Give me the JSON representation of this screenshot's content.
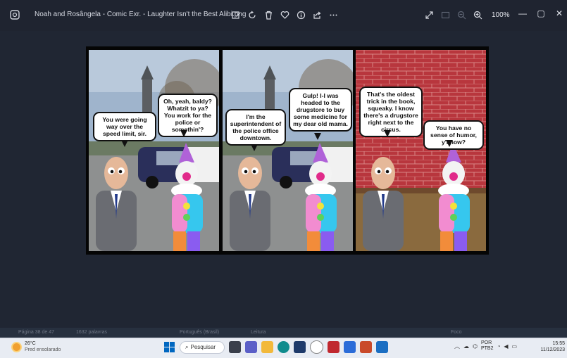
{
  "titlebar": {
    "filename": "Noah and Rosângela - Comic Exr. - Laughter Isn't the Best Alibi.png",
    "zoom": "100%",
    "tools": [
      "edit-icon",
      "rotate-icon",
      "delete-icon",
      "favorite-icon",
      "info-icon",
      "share-icon",
      "more-icon"
    ],
    "right_tools": [
      "fullscreen-icon",
      "fit-icon",
      "zoom-out-icon",
      "zoom-in-icon"
    ]
  },
  "comic": {
    "panels": [
      {
        "bubbles": [
          "You were going way over the speed limit, sir.",
          "Oh, yeah, baldy? Whatzit to ya? You work for the police or somethin'?"
        ]
      },
      {
        "bubbles": [
          "I'm the superintendent of the police office downtown.",
          "Gulp! I-I was headed to the drugstore to buy some medicine for my dear old mama."
        ]
      },
      {
        "bubbles": [
          "That's the oldest trick in the book, squeaky. I know there's a drugstore right next to the circus.",
          "You have no sense of humor, y'know?"
        ]
      }
    ]
  },
  "background_strip": [
    "Página 38 de 47",
    "1632 palavras",
    "Português (Brasil)",
    "Leitura",
    "Foco"
  ],
  "taskbar": {
    "weather_temp": "26°C",
    "weather_desc": "Pred ensolarado",
    "search_label": "Pesquisar",
    "lang_top": "POR",
    "lang_bottom": "PTB2",
    "time": "15:55",
    "date": "11/12/2023"
  },
  "colors": {
    "titlebar": "#1f2430",
    "canvas": "#202633",
    "taskbar": "#e8ecf3",
    "accent": "#0067c0"
  }
}
